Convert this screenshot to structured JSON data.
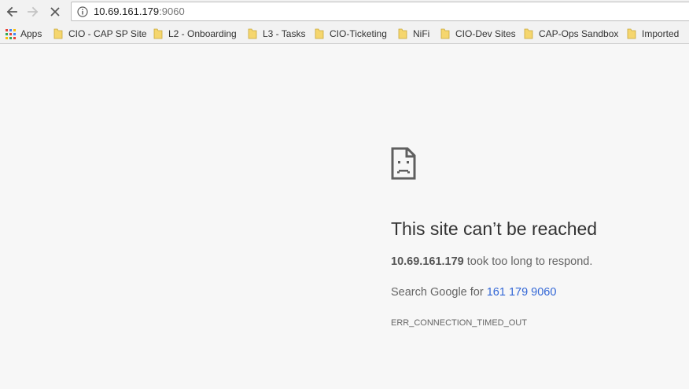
{
  "omnibox": {
    "host": "10.69.161.179",
    "port": ":9060"
  },
  "bookmarks": {
    "apps_label": "Apps",
    "items": [
      {
        "label": "CIO - CAP SP Site"
      },
      {
        "label": "L2 - Onboarding"
      },
      {
        "label": "L3 - Tasks"
      },
      {
        "label": "CIO-Ticketing"
      },
      {
        "label": "NiFi"
      },
      {
        "label": "CIO-Dev Sites"
      },
      {
        "label": "CAP-Ops Sandbox"
      },
      {
        "label": "Imported"
      }
    ]
  },
  "error": {
    "title": "This site can’t be reached",
    "host": "10.69.161.179",
    "detail_suffix": " took too long to respond.",
    "search_prefix": "Search Google for ",
    "search_query": "161 179 9060",
    "code": "ERR_CONNECTION_TIMED_OUT"
  },
  "colors": {
    "link": "#3367d6",
    "folder": "#f5d66e",
    "background": "#f7f7f7"
  },
  "icons": [
    "back-arrow-icon",
    "forward-arrow-icon",
    "stop-icon",
    "info-icon",
    "apps-grid-icon",
    "folder-icon",
    "sad-page-icon"
  ]
}
